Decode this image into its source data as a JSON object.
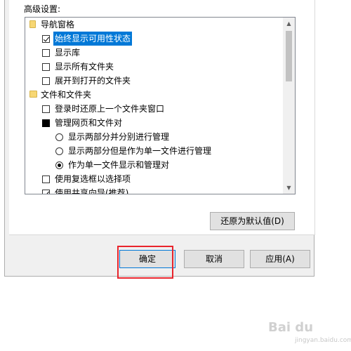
{
  "advanced_settings": {
    "label": "高级设置:",
    "items": [
      {
        "type": "group",
        "icon": "folder-icon",
        "label": "导航窗格"
      },
      {
        "type": "checkbox",
        "checked": true,
        "selected": true,
        "label": "始终显示可用性状态"
      },
      {
        "type": "checkbox",
        "checked": false,
        "label": "显示库"
      },
      {
        "type": "checkbox",
        "checked": false,
        "label": "显示所有文件夹"
      },
      {
        "type": "checkbox",
        "checked": false,
        "label": "展开到打开的文件夹"
      },
      {
        "type": "group",
        "icon": "folder-icon",
        "label": "文件和文件夹"
      },
      {
        "type": "checkbox",
        "checked": false,
        "label": "登录时还原上一个文件夹窗口"
      },
      {
        "type": "checkbox",
        "checked": "indeterminate",
        "label": "管理网页和文件对"
      },
      {
        "type": "radio",
        "selected": false,
        "label": "显示两部分并分别进行管理"
      },
      {
        "type": "radio",
        "selected": false,
        "label": "显示两部分但是作为单一文件进行管理"
      },
      {
        "type": "radio",
        "selected": true,
        "label": "作为单一文件显示和管理对"
      },
      {
        "type": "checkbox",
        "checked": false,
        "label": "使用复选框以选择项"
      },
      {
        "type": "checkbox",
        "checked": true,
        "label": "使用共享向导(推荐)"
      }
    ]
  },
  "buttons": {
    "restore_defaults": "还原为默认值(D)",
    "ok": "确定",
    "cancel": "取消",
    "apply": "应用(A)"
  },
  "watermark": {
    "text": "Bai du",
    "sub": "jingyan.baidu.com"
  },
  "colors": {
    "highlight": "#0078d7",
    "annotation": "#e8242c"
  }
}
